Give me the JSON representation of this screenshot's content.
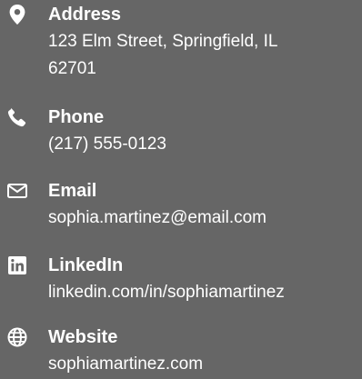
{
  "contact": {
    "items": [
      {
        "icon": "map-marker-icon",
        "label": "Address",
        "value_line1": "123 Elm Street, Springfield, IL",
        "value_line2": "62701"
      },
      {
        "icon": "phone-icon",
        "label": "Phone",
        "value": "(217) 555-0123"
      },
      {
        "icon": "envelope-icon",
        "label": "Email",
        "value": "sophia.martinez@email.com"
      },
      {
        "icon": "linkedin-icon",
        "label": "LinkedIn",
        "value": "linkedin.com/in/sophiamartinez"
      },
      {
        "icon": "globe-icon",
        "label": "Website",
        "value": "sophiamartinez.com"
      }
    ]
  },
  "colors": {
    "background": "#666666",
    "text": "#ffffff"
  }
}
